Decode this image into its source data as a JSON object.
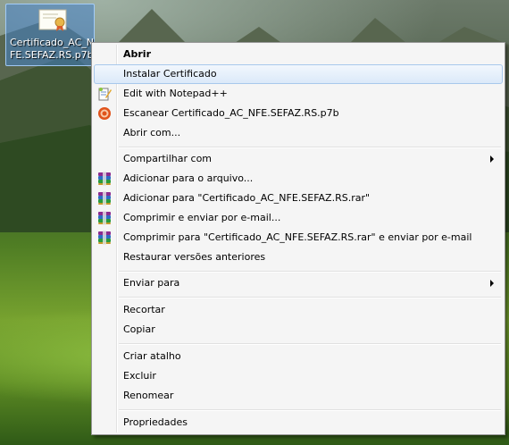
{
  "desktop_icon": {
    "caption_line1": "Certificado_AC_N",
    "caption_line2": "FE.SEFAZ.RS.p7b"
  },
  "context_menu": {
    "items": [
      {
        "label": "Abrir",
        "bold": true
      },
      {
        "label": "Instalar Certificado",
        "hover": true
      },
      {
        "label": "Edit with Notepad++",
        "icon": "notepad-icon"
      },
      {
        "label": "Escanear Certificado_AC_NFE.SEFAZ.RS.p7b",
        "icon": "antivirus-icon"
      },
      {
        "label": "Abrir com..."
      },
      {
        "label": "Compartilhar com",
        "submenu": true
      },
      {
        "label": "Adicionar para o arquivo...",
        "icon": "winrar-icon"
      },
      {
        "label": "Adicionar para \"Certificado_AC_NFE.SEFAZ.RS.rar\"",
        "icon": "winrar-icon"
      },
      {
        "label": "Comprimir e enviar por e-mail...",
        "icon": "winrar-icon"
      },
      {
        "label": "Comprimir para \"Certificado_AC_NFE.SEFAZ.RS.rar\" e enviar por e-mail",
        "icon": "winrar-icon"
      },
      {
        "label": "Restaurar versões anteriores"
      },
      {
        "label": "Enviar para",
        "submenu": true
      },
      {
        "label": "Recortar"
      },
      {
        "label": "Copiar"
      },
      {
        "label": "Criar atalho"
      },
      {
        "label": "Excluir"
      },
      {
        "label": "Renomear"
      },
      {
        "label": "Propriedades"
      }
    ]
  },
  "colors": {
    "menu_background": "#f5f5f5",
    "hover_border": "#a8c8ec",
    "icon_selection": "#4682c8"
  }
}
